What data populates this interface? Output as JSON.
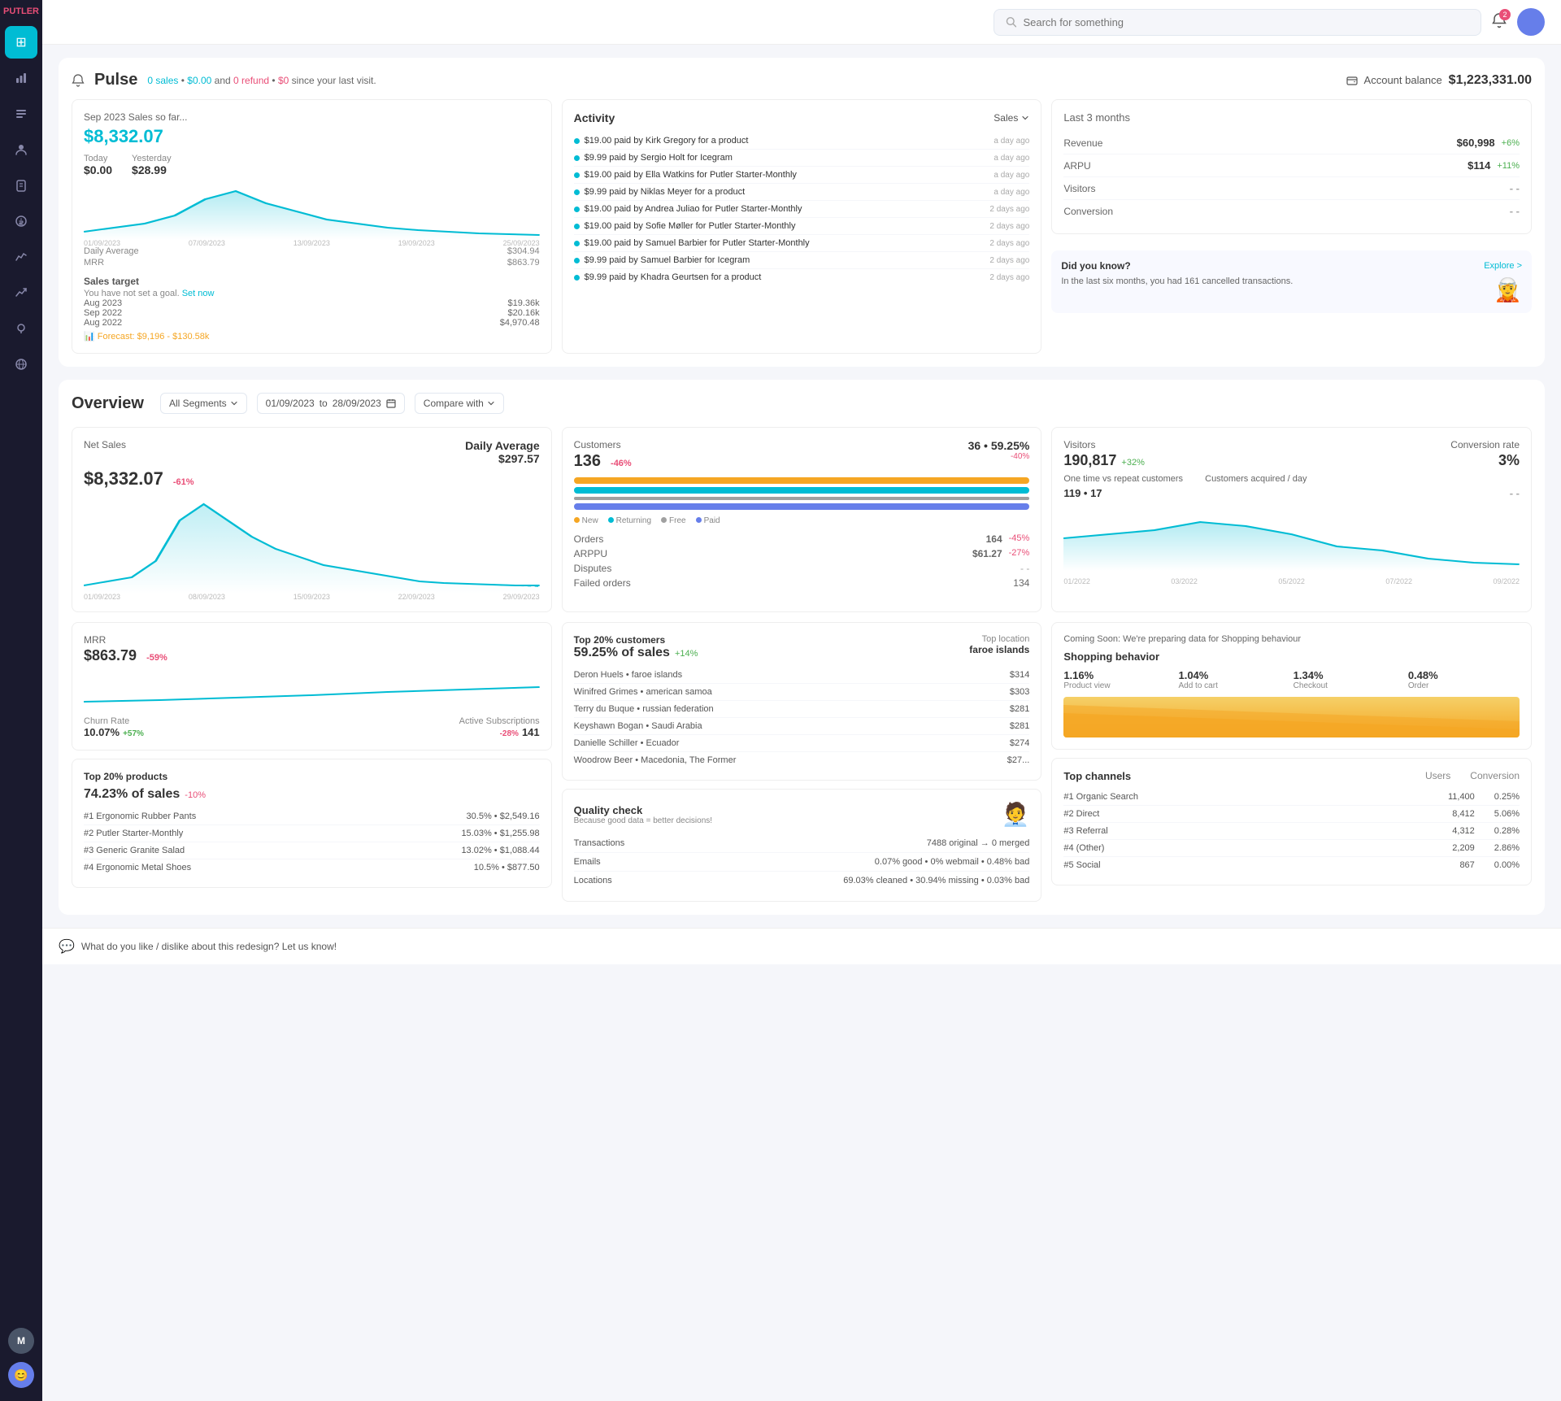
{
  "app": {
    "name": "PUTLER",
    "search_placeholder": "Search for something"
  },
  "header": {
    "notif_count": "2",
    "account_balance_label": "Account balance",
    "account_balance_value": "$1,223,331.00"
  },
  "pulse": {
    "title": "Pulse",
    "subtitle_sales": "0 sales",
    "subtitle_amount": "$0.00",
    "subtitle_refund": "0 refund",
    "subtitle_refund_amount": "$0",
    "subtitle_suffix": "since your last visit.",
    "sales_period": "Sep 2023 Sales so far...",
    "sales_amount": "$8,332.07",
    "today_label": "Today",
    "today_value": "$0.00",
    "yesterday_label": "Yesterday",
    "yesterday_value": "$28.99",
    "daily_avg_label": "Daily Average",
    "daily_avg_value": "$304.94",
    "mrr_label": "MRR",
    "mrr_value": "$863.79",
    "sales_target_title": "Sales target",
    "set_goal_text": "You have not set a goal.",
    "set_now_label": "Set now",
    "targets": [
      {
        "period": "Aug 2023",
        "value": "$19.36k"
      },
      {
        "period": "Sep 2022",
        "value": "$20.16k"
      },
      {
        "period": "Aug 2022",
        "value": "$4,970.48"
      }
    ],
    "forecast": "Forecast: $9,196 - $130.58k",
    "activity": {
      "title": "Activity",
      "filter": "Sales",
      "items": [
        {
          "text": "$19.00 paid by Kirk Gregory for a product",
          "time": "a day ago"
        },
        {
          "text": "$9.99 paid by Sergio Holt for Icegram",
          "time": "a day ago"
        },
        {
          "text": "$19.00 paid by Ella Watkins for Putler Starter-Monthly",
          "time": "a day ago"
        },
        {
          "text": "$9.99 paid by Niklas Meyer for a product",
          "time": "a day ago"
        },
        {
          "text": "$19.00 paid by Andrea Juliao for Putler Starter-Monthly",
          "time": "2 days ago"
        },
        {
          "text": "$19.00 paid by Sofie Møller for Putler Starter-Monthly",
          "time": "2 days ago"
        },
        {
          "text": "$19.00 paid by Samuel Barbier for Putler Starter-Monthly",
          "time": "2 days ago"
        },
        {
          "text": "$9.99 paid by Samuel Barbier for Icegram",
          "time": "2 days ago"
        },
        {
          "text": "$9.99 paid by Khadra Geurtsen for a product",
          "time": "2 days ago"
        }
      ]
    },
    "last_3_months": {
      "title": "Last 3 months",
      "items": [
        {
          "label": "Revenue",
          "value": "$60,998",
          "change": "+6%",
          "positive": true
        },
        {
          "label": "ARPU",
          "value": "$114",
          "change": "+11%",
          "positive": true
        },
        {
          "label": "Visitors",
          "value": "- -",
          "change": "",
          "positive": null
        },
        {
          "label": "Conversion",
          "value": "- -",
          "change": "",
          "positive": null
        }
      ]
    },
    "did_you_know": {
      "title": "Did you know?",
      "explore_label": "Explore >",
      "text": "In the last six months, you had 161 cancelled transactions."
    }
  },
  "overview": {
    "title": "Overview",
    "segment_label": "All Segments",
    "date_from": "01/09/2023",
    "date_to": "28/09/2023",
    "compare_label": "Compare with",
    "net_sales": {
      "label": "Net Sales",
      "value": "$8,332.07",
      "change": "-61%",
      "positive": false,
      "daily_avg_label": "Daily Average",
      "daily_avg_value": "$297.57"
    },
    "customers": {
      "label": "Customers",
      "value": "136",
      "change": "-46%",
      "positive": false,
      "right_value": "36 • 59.25%",
      "right_change": "-40%",
      "orders_label": "Orders",
      "orders_value": "164",
      "orders_change": "-45%",
      "arppu_label": "ARPPU",
      "arppu_value": "$61.27",
      "arppu_change": "-27%",
      "disputes_label": "Disputes",
      "disputes_value": "- -",
      "failed_label": "Failed orders",
      "failed_value": "134",
      "legend": [
        "New",
        "Returning",
        "Free",
        "Paid"
      ],
      "legend_colors": [
        "#f5a623",
        "#00bcd4",
        "#4caf50",
        "#667eea"
      ],
      "bars": [
        {
          "color": "#f5a623",
          "width": "25%"
        },
        {
          "color": "#00bcd4",
          "width": "60%"
        },
        {
          "color": "#4caf50",
          "width": "10%"
        },
        {
          "color": "#667eea",
          "width": "75%"
        }
      ]
    },
    "visitors": {
      "label": "Visitors",
      "value": "190,817",
      "value_change": "+32%",
      "conversion_label": "Conversion rate",
      "conversion_value": "3%",
      "one_time_label": "One time vs repeat customers",
      "one_time_value": "119 • 17",
      "acquired_label": "Customers acquired / day",
      "acquired_value": "- -",
      "date_labels": [
        "01/2022",
        "03/2022",
        "05/2022",
        "07/2022",
        "09/2022"
      ]
    },
    "mrr": {
      "label": "MRR",
      "value": "$863.79",
      "change": "-59%",
      "positive": false,
      "churn_label": "Churn Rate",
      "churn_value": "10.07%",
      "churn_change": "+57%",
      "active_subs_label": "Active Subscriptions",
      "active_subs_value": "141",
      "active_subs_change": "-28%"
    },
    "top_products": {
      "label": "Top 20% products",
      "sales_label": "74.23% of sales",
      "sales_change": "-10%",
      "items": [
        {
          "rank": "#1 Ergonomic Rubber Pants",
          "pct": "30.5%",
          "value": "$2,549.16"
        },
        {
          "rank": "#2 Putler Starter-Monthly",
          "pct": "15.03%",
          "value": "$1,255.98"
        },
        {
          "rank": "#3 Generic Granite Salad",
          "pct": "13.02%",
          "value": "$1,088.44"
        },
        {
          "rank": "#4 Ergonomic Metal Shoes",
          "pct": "10.5%",
          "value": "$877.50"
        }
      ]
    },
    "top_customers": {
      "label": "Top 20% customers",
      "sales_label": "59.25% of sales",
      "sales_change": "+14%",
      "top_location_label": "Top location",
      "top_location_value": "faroe islands",
      "items": [
        {
          "name": "Deron Huels • faroe islands",
          "value": "$314"
        },
        {
          "name": "Winifred Grimes • american samoa",
          "value": "$303"
        },
        {
          "name": "Terry du Buque • russian federation",
          "value": "$281"
        },
        {
          "name": "Keyshawn Bogan • Saudi Arabia",
          "value": "$281"
        },
        {
          "name": "Danielle Schiller • Ecuador",
          "value": "$274"
        },
        {
          "name": "Woodrow Beer • Macedonia, The Former",
          "value": "$27..."
        }
      ]
    },
    "quality_check": {
      "title": "Quality check",
      "subtitle": "Because good data = better decisions!",
      "items": [
        {
          "label": "Transactions",
          "value": "7488 original → 0 merged"
        },
        {
          "label": "Emails",
          "value": "0.07% good • 0% webmail • 0.48% bad"
        },
        {
          "label": "Locations",
          "value": "69.03% cleaned • 30.94% missing • 0.03% bad"
        }
      ]
    },
    "shopping_behavior": {
      "coming_soon_text": "Coming Soon: We're preparing data for Shopping behaviour",
      "title": "Shopping behavior",
      "stats": [
        {
          "value": "1.16%",
          "label": "Product view"
        },
        {
          "value": "1.04%",
          "label": "Add to cart"
        },
        {
          "value": "1.34%",
          "label": "Checkout"
        },
        {
          "value": "0.48%",
          "label": "Order"
        }
      ],
      "funnel_bars": [
        100,
        90,
        60,
        40
      ]
    },
    "top_channels": {
      "title": "Top channels",
      "users_label": "Users",
      "conversion_label": "Conversion",
      "items": [
        {
          "name": "#1 Organic Search",
          "users": "11,400",
          "conversion": "0.25%"
        },
        {
          "name": "#2 Direct",
          "users": "8,412",
          "conversion": "5.06%"
        },
        {
          "name": "#3 Referral",
          "users": "4,312",
          "conversion": "0.28%"
        },
        {
          "name": "#4 (Other)",
          "users": "2,209",
          "conversion": "2.86%"
        },
        {
          "name": "#5 Social",
          "users": "867",
          "conversion": "0.00%"
        }
      ]
    }
  },
  "feedback": {
    "text": "What do you like / dislike about this redesign? Let us know!"
  },
  "sidebar": {
    "items": [
      {
        "icon": "⊞",
        "name": "dashboard",
        "active": true
      },
      {
        "icon": "💰",
        "name": "revenue",
        "active": false
      },
      {
        "icon": "☰",
        "name": "orders",
        "active": false
      },
      {
        "icon": "👤",
        "name": "customers",
        "active": false
      },
      {
        "icon": "📋",
        "name": "reports",
        "active": false
      },
      {
        "icon": "💸",
        "name": "payouts",
        "active": false
      },
      {
        "icon": "📊",
        "name": "analytics",
        "active": false
      },
      {
        "icon": "📈",
        "name": "trends",
        "active": false
      },
      {
        "icon": "💡",
        "name": "insights",
        "active": false
      },
      {
        "icon": "🌐",
        "name": "global",
        "active": false
      }
    ]
  }
}
